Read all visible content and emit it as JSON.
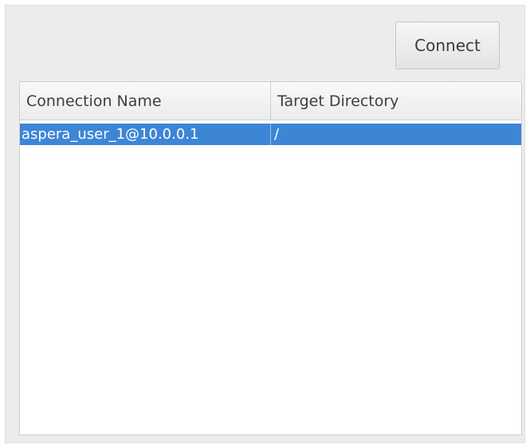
{
  "toolbar": {
    "connect_label": "Connect"
  },
  "table": {
    "columns": [
      "Connection Name",
      "Target Directory"
    ],
    "rows": [
      {
        "connection_name": "aspera_user_1@10.0.0.1",
        "target_directory": "/",
        "selected": true
      }
    ]
  },
  "colors": {
    "selection": "#3d86d6",
    "window_background": "#ececec"
  }
}
